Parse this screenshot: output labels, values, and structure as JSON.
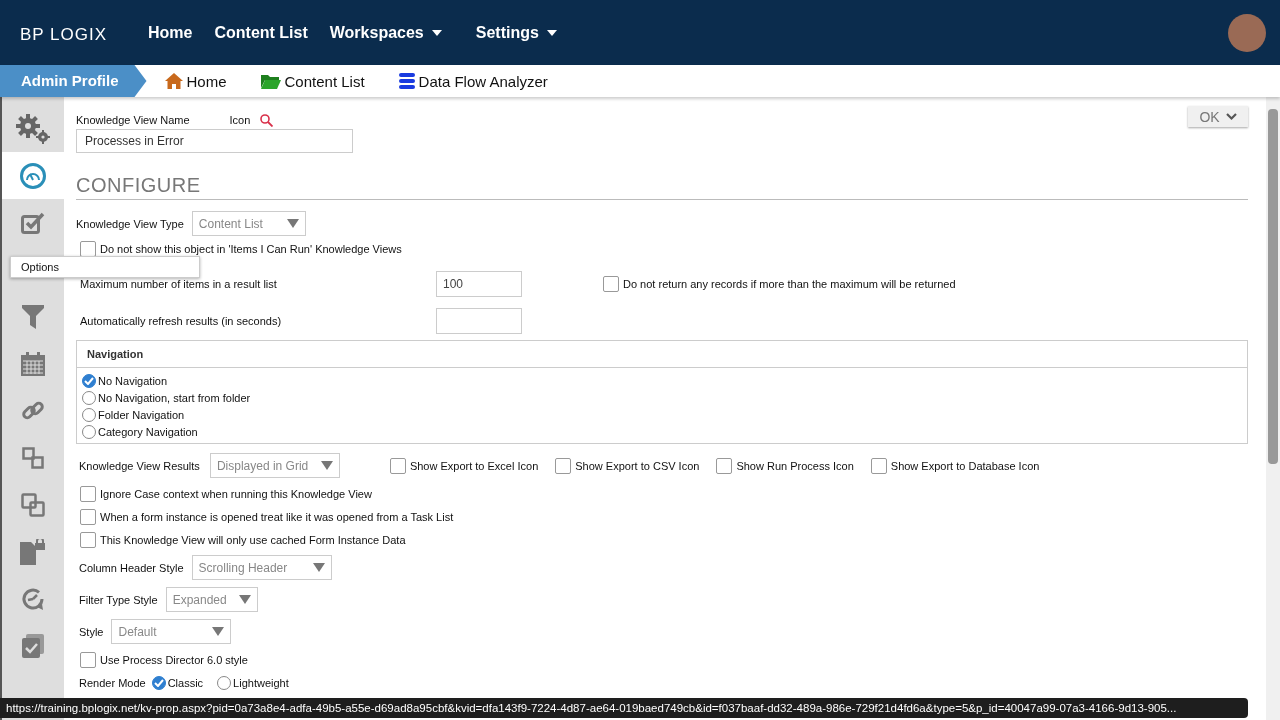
{
  "brand": "BP LOGIX",
  "nav": [
    {
      "label": "Home",
      "dropdown": false
    },
    {
      "label": "Content List",
      "dropdown": false
    },
    {
      "label": "Workspaces",
      "dropdown": true
    },
    {
      "label": "Settings",
      "dropdown": true
    }
  ],
  "breadcrumb": {
    "current": "Admin Profile",
    "links": [
      {
        "kind": "home",
        "label": "Home"
      },
      {
        "kind": "folder",
        "label": "Content List"
      },
      {
        "kind": "database",
        "label": "Data Flow Analyzer"
      }
    ]
  },
  "sidebar": {
    "items": [
      {
        "kind": "gears",
        "selected": false
      },
      {
        "kind": "gauge",
        "selected": true
      },
      {
        "kind": "checkbox",
        "selected": false
      },
      {
        "kind": "funnel",
        "selected": false
      },
      {
        "kind": "calendar",
        "selected": false
      },
      {
        "kind": "link",
        "selected": false
      },
      {
        "kind": "squares",
        "selected": false
      },
      {
        "kind": "copy",
        "selected": false
      },
      {
        "kind": "lockdoc",
        "selected": false
      },
      {
        "kind": "clock",
        "selected": false
      },
      {
        "kind": "checkdoc",
        "selected": false
      }
    ],
    "tooltip": "Options"
  },
  "ok_button": "OK",
  "name_field": {
    "label": "Knowledge View Name",
    "icon_label": "Icon",
    "value": "Processes in Error"
  },
  "section_title": "CONFIGURE",
  "kv_type": {
    "label": "Knowledge View Type",
    "value": "Content List"
  },
  "hide_option": {
    "label": "Do not show this object in 'Items I Can Run' Knowledge Views",
    "checked": false
  },
  "max_items": {
    "label": "Maximum number of items in a result list",
    "value": "100"
  },
  "no_records": {
    "label": "Do not return any records if more than the maximum will be returned",
    "checked": false
  },
  "refresh": {
    "label": "Automatically refresh results (in seconds)"
  },
  "navigation": {
    "title": "Navigation",
    "options": [
      {
        "label": "No Navigation",
        "selected": true
      },
      {
        "label": "No Navigation, start from folder",
        "selected": false
      },
      {
        "label": "Folder Navigation",
        "selected": false
      },
      {
        "label": "Category Navigation",
        "selected": false
      }
    ]
  },
  "results": {
    "label": "Knowledge View Results",
    "value": "Displayed in Grid",
    "exports": [
      {
        "label": "Show Export to Excel Icon",
        "checked": false
      },
      {
        "label": "Show Export to CSV Icon",
        "checked": false
      },
      {
        "label": "Show Run Process Icon",
        "checked": false
      },
      {
        "label": "Show Export to Database Icon",
        "checked": false
      }
    ]
  },
  "options": [
    {
      "label": "Ignore Case context when running this Knowledge View",
      "checked": false
    },
    {
      "label": "When a form instance is opened treat like it was opened from a Task List",
      "checked": false
    },
    {
      "label": "This Knowledge View will only use cached Form Instance Data",
      "checked": false
    }
  ],
  "selects": [
    {
      "label": "Column Header Style",
      "value": "Scrolling Header"
    },
    {
      "label": "Filter Type Style",
      "value": "Expanded"
    },
    {
      "label": "Style",
      "value": "Default"
    }
  ],
  "pd6_style": {
    "label": "Use Process Director 6.0 style",
    "checked": false
  },
  "render_mode": {
    "label": "Render Mode",
    "options": [
      {
        "label": "Classic",
        "selected": true
      },
      {
        "label": "Lightweight",
        "selected": false
      }
    ]
  },
  "status_url": "https://training.bplogix.net/kv-prop.aspx?pid=0a73a8e4-adfa-49b5-a55e-d69ad8a95cbf&kvid=dfa143f9-7224-4d87-ae64-019baed749cb&id=f037baaf-dd32-489a-986e-729f21d4fd6a&type=5&p_id=40047a99-07a3-4166-9d13-905..."
}
